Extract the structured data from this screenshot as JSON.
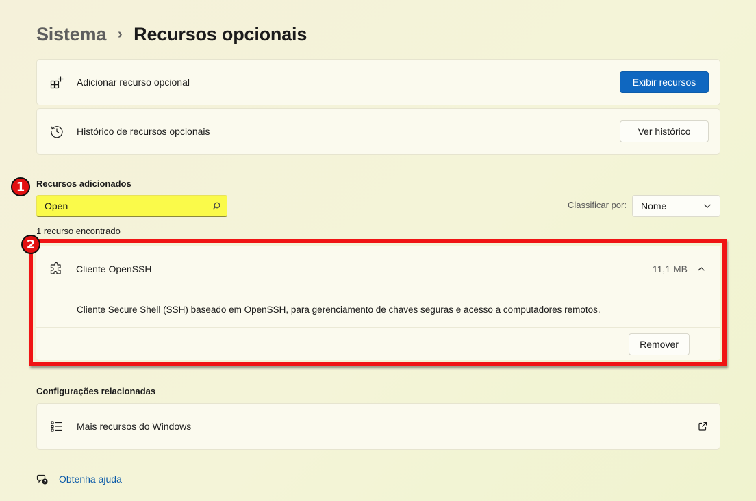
{
  "breadcrumb": {
    "parent": "Sistema",
    "separator": "›",
    "current": "Recursos opcionais"
  },
  "add_feature": {
    "label": "Adicionar recurso opcional",
    "button": "Exibir recursos",
    "icon": "add-grid-icon"
  },
  "history": {
    "label": "Histórico de recursos opcionais",
    "button": "Ver histórico",
    "icon": "history-icon"
  },
  "added_features": {
    "title": "Recursos adicionados",
    "search_value": "Open",
    "sort_label": "Classificar por:",
    "sort_value": "Nome",
    "found_text": "1 recurso encontrado",
    "item": {
      "name": "Cliente OpenSSH",
      "size": "11,1 MB",
      "description": "Cliente Secure Shell (SSH) baseado em OpenSSH, para gerenciamento de chaves seguras e acesso a computadores remotos.",
      "remove_button": "Remover",
      "icon": "puzzle-icon"
    }
  },
  "related": {
    "title": "Configurações relacionadas",
    "item_label": "Mais recursos do Windows",
    "icon": "list-icon"
  },
  "help": {
    "link": "Obtenha ajuda"
  },
  "annotations": {
    "marker1": "1",
    "marker2": "2"
  },
  "colors": {
    "accent": "#0f67c0",
    "highlight_yellow": "#fafa4a",
    "annotation_red": "#f01414"
  }
}
